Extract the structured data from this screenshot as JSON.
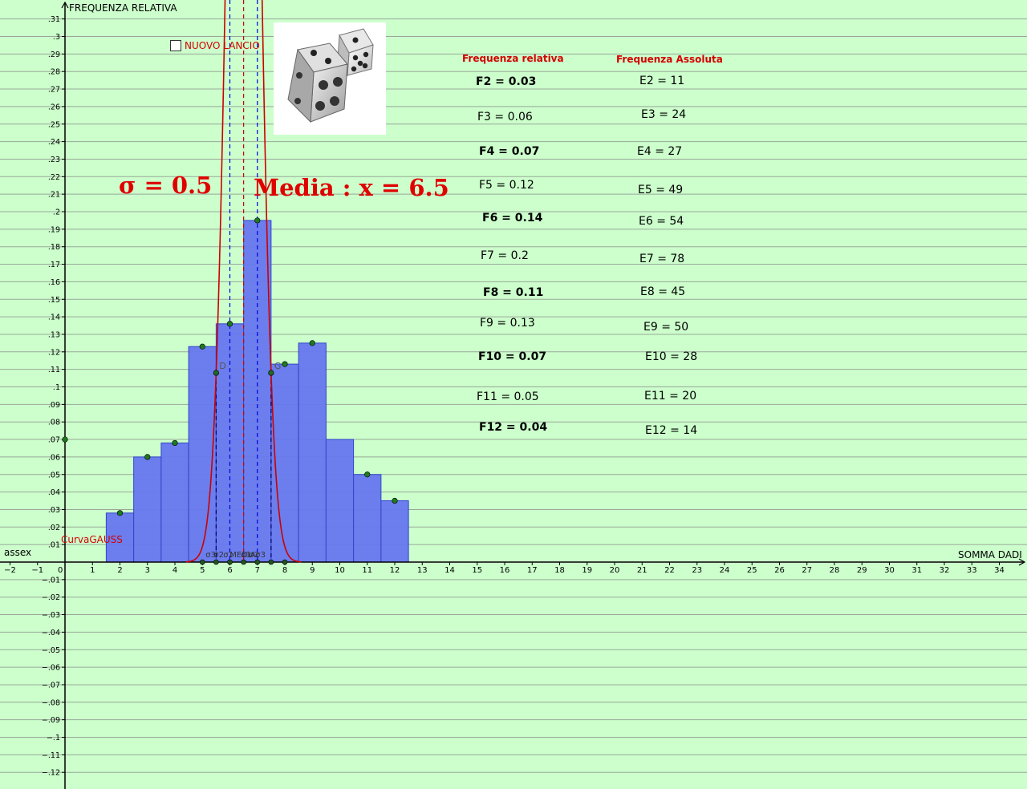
{
  "axes": {
    "y_title": "FREQUENZA RELATIVA",
    "x_title": "SOMMA DADI",
    "x_axis_label": "assex",
    "curve_label": "CurvaGAUSS"
  },
  "controls": {
    "new_roll_label": "NUOVO LANCIO",
    "new_roll_checked": false
  },
  "images": {
    "dice": "dice-image"
  },
  "overlays": {
    "sigma_text": "σ = 0.5",
    "mean_text": "Media : x = 6.5"
  },
  "table": {
    "relative_header": "Frequenza relativa",
    "absolute_header": "Frequenza Assoluta",
    "relative": [
      {
        "text": "F2 = 0.03",
        "bold": true
      },
      {
        "text": "F3 = 0.06",
        "bold": false
      },
      {
        "text": "F4 = 0.07",
        "bold": true
      },
      {
        "text": "F5 = 0.12",
        "bold": false
      },
      {
        "text": "F6 = 0.14",
        "bold": true
      },
      {
        "text": "F7 = 0.2",
        "bold": false
      },
      {
        "text": "F8 = 0.11",
        "bold": true
      },
      {
        "text": "F9 = 0.13",
        "bold": false
      },
      {
        "text": "F10 = 0.07",
        "bold": true
      },
      {
        "text": "F11 = 0.05",
        "bold": false
      },
      {
        "text": "F12 = 0.04",
        "bold": true
      }
    ],
    "absolute": [
      {
        "text": "E2 = 11"
      },
      {
        "text": "E3 = 24"
      },
      {
        "text": "E4 = 27"
      },
      {
        "text": "E5 = 49"
      },
      {
        "text": "E6 = 54"
      },
      {
        "text": "E7 = 78"
      },
      {
        "text": "E8 = 45"
      },
      {
        "text": "E9 = 50"
      },
      {
        "text": "E10 = 28"
      },
      {
        "text": "E11 = 20"
      },
      {
        "text": "E12 = 14"
      }
    ]
  },
  "chart_data": {
    "type": "bar",
    "xlabel": "SOMMA DADI",
    "ylabel": "FREQUENZA RELATIVA",
    "xlim": [
      -2.4,
      34.8
    ],
    "ylim": [
      -0.128,
      0.32
    ],
    "x_ticks": [
      -2,
      -1,
      0,
      1,
      2,
      3,
      4,
      5,
      6,
      7,
      8,
      9,
      10,
      11,
      12,
      13,
      14,
      15,
      16,
      17,
      18,
      19,
      20,
      21,
      22,
      23,
      24,
      25,
      26,
      27,
      28,
      29,
      30,
      31,
      32,
      33,
      34
    ],
    "y_ticks": [
      -0.12,
      -0.11,
      -0.1,
      -0.09,
      -0.08,
      -0.07,
      -0.06,
      -0.05,
      -0.04,
      -0.03,
      -0.02,
      -0.01,
      0,
      0.01,
      0.02,
      0.03,
      0.04,
      0.05,
      0.06,
      0.07,
      0.08,
      0.09,
      0.1,
      0.11,
      0.12,
      0.13,
      0.14,
      0.15,
      0.16,
      0.17,
      0.18,
      0.19,
      0.2,
      0.21,
      0.22,
      0.23,
      0.24,
      0.25,
      0.26,
      0.27,
      0.28,
      0.29,
      0.3,
      0.31
    ],
    "grid": "horizontal",
    "bars": {
      "categories": [
        2,
        3,
        4,
        5,
        6,
        7,
        8,
        9,
        10,
        11,
        12
      ],
      "heights": [
        0.028,
        0.06,
        0.068,
        0.123,
        0.136,
        0.195,
        0.113,
        0.125,
        0.07,
        0.05,
        0.035
      ],
      "color": "#6677ee"
    },
    "points": [
      {
        "x": 2,
        "y": 0.028
      },
      {
        "x": 3,
        "y": 0.06
      },
      {
        "x": 4,
        "y": 0.068
      },
      {
        "x": 5,
        "y": 0.123
      },
      {
        "x": 6,
        "y": 0.136
      },
      {
        "x": 7,
        "y": 0.195
      },
      {
        "x": 8,
        "y": 0.113
      },
      {
        "x": 9,
        "y": 0.125
      },
      {
        "x": 11,
        "y": 0.05
      },
      {
        "x": 12,
        "y": 0.035
      },
      {
        "x": 0,
        "y": 0.07
      }
    ],
    "gauss": {
      "mean": 6.5,
      "sigma": 0.5,
      "color": "#cc0000"
    },
    "markers": [
      {
        "name": "D",
        "x": 5.5,
        "y": 0.108
      },
      {
        "name": "G",
        "x": 7.5,
        "y": 0.108
      }
    ],
    "guide_lines": [
      {
        "x": 5.5,
        "color": "#000066",
        "to": 0.108
      },
      {
        "x": 6.0,
        "color": "#0000dd",
        "to": 0.32
      },
      {
        "x": 6.5,
        "color": "#cc0000",
        "to": 0.32
      },
      {
        "x": 7.0,
        "color": "#0000dd",
        "to": 0.32
      },
      {
        "x": 7.5,
        "color": "#000066",
        "to": 0.108
      }
    ],
    "axis_points": [
      {
        "x": 5.0,
        "label": "σ3"
      },
      {
        "x": 5.5,
        "label": "σ2"
      },
      {
        "x": 6.0,
        "label": "σ1"
      },
      {
        "x": 6.5,
        "label": "MEDIA"
      },
      {
        "x": 7.0,
        "label": "σ1"
      },
      {
        "x": 7.5,
        "label": "σ2"
      },
      {
        "x": 8.0,
        "label": "σ3"
      }
    ]
  }
}
